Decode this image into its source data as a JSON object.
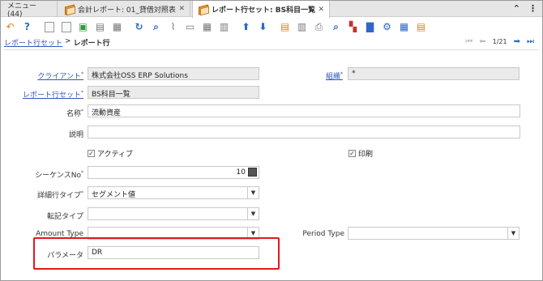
{
  "tabs": {
    "menu_label": "メニュー (44)",
    "tab1_label": "会計レポート: 01_貸借対照表",
    "tab2_label": "レポート行セット: BS科目一覧",
    "close_glyph": "✕",
    "collapse_glyph": "⌃",
    "more_glyph": "⋮"
  },
  "breadcrumb": {
    "parent": "レポート行セット",
    "separator": ">",
    "current": "レポート行"
  },
  "record_nav": {
    "first": "⏮",
    "prev": "⬅",
    "position": "1/21",
    "next": "➡",
    "last": "⏭"
  },
  "form": {
    "client_label": "クライアント",
    "client_value": "株式会社OSS ERP Solutions",
    "org_label": "組織",
    "org_value": "*",
    "line_set_label": "レポート行セット",
    "line_set_value": "BS科目一覧",
    "name_label": "名称",
    "name_value": "流動資産",
    "description_label": "説明",
    "description_value": "",
    "active_label": "アクティブ",
    "active_checked": "✓",
    "print_label": "印刷",
    "print_checked": "✓",
    "sequence_label": "シーケンスNo",
    "sequence_value": "10",
    "line_type_label": "詳細行タイプ",
    "line_type_value": "セグメント値",
    "posting_type_label": "転記タイプ",
    "posting_type_value": "",
    "amount_type_label": "Amount Type",
    "amount_type_value": "",
    "period_type_label": "Period Type",
    "period_type_value": "",
    "parameter_label": "パラメータ",
    "parameter_value": "DR",
    "required_mark": "*",
    "dropdown_arrow": "▼"
  },
  "colors": {
    "accent_blue": "#2e67c8",
    "highlight_red": "#e0191c",
    "readonly_bg": "#ebebeb"
  }
}
